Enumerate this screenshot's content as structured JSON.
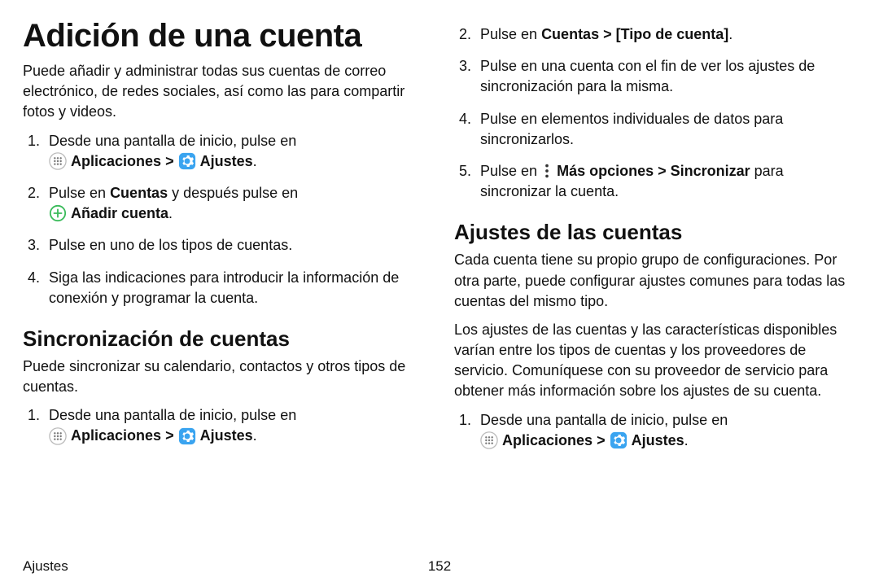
{
  "title": "Adición de una cuenta",
  "intro": "Puede añadir y administrar todas sus cuentas de correo electrónico, de redes sociales, así como las para compartir fotos y videos.",
  "addSteps": {
    "step1_prefix": "Desde una pantalla de inicio, pulse en ",
    "apps_label": "Aplicaciones",
    "separator": " > ",
    "settings_label": "Ajustes",
    "period": ".",
    "step2_prefix": "Pulse en ",
    "step2_cuentas": "Cuentas",
    "step2_middle": " y después pulse en ",
    "step2_add_label": "Añadir cuenta",
    "step3": "Pulse en uno de los tipos de cuentas.",
    "step4": "Siga las indicaciones para introducir la información de conexión y programar la cuenta."
  },
  "sync": {
    "heading": "Sincronización de cuentas",
    "intro": "Puede sincronizar su calendario, contactos y otros tipos de cuentas.",
    "step1_prefix": "Desde una pantalla de inicio, pulse en ",
    "apps_label": "Aplicaciones",
    "separator": " > ",
    "settings_label": "Ajustes",
    "period": "."
  },
  "right": {
    "step2_prefix": "Pulse en ",
    "step2_cuentas": "Cuentas",
    "step2_sep": " > ",
    "step2_tipo": "[Tipo de cuenta]",
    "step2_period": ".",
    "step3": "Pulse en una cuenta con el fin de ver los ajustes de sincronización para la misma.",
    "step4": "Pulse en elementos individuales de datos para sincronizarlos.",
    "step5_prefix": "Pulse en ",
    "step5_more": "Más opciones",
    "step5_sep": " > ",
    "step5_sync": "Sincronizar",
    "step5_suffix": " para sincronizar la cuenta."
  },
  "accountSettings": {
    "heading": "Ajustes de las cuentas",
    "p1": "Cada cuenta tiene su propio grupo de configuraciones. Por otra parte, puede configurar ajustes comunes para todas las cuentas del mismo tipo.",
    "p2": "Los ajustes de las cuentas y las características disponibles varían entre los tipos de cuentas y los proveedores de servicio. Comuníquese con su proveedor de servicio para obtener más información sobre los ajustes de su cuenta.",
    "step1_prefix": "Desde una pantalla de inicio, pulse en ",
    "apps_label": "Aplicaciones",
    "separator": " > ",
    "settings_label": "Ajustes",
    "period": "."
  },
  "footer": {
    "section": "Ajustes",
    "page": "152"
  }
}
